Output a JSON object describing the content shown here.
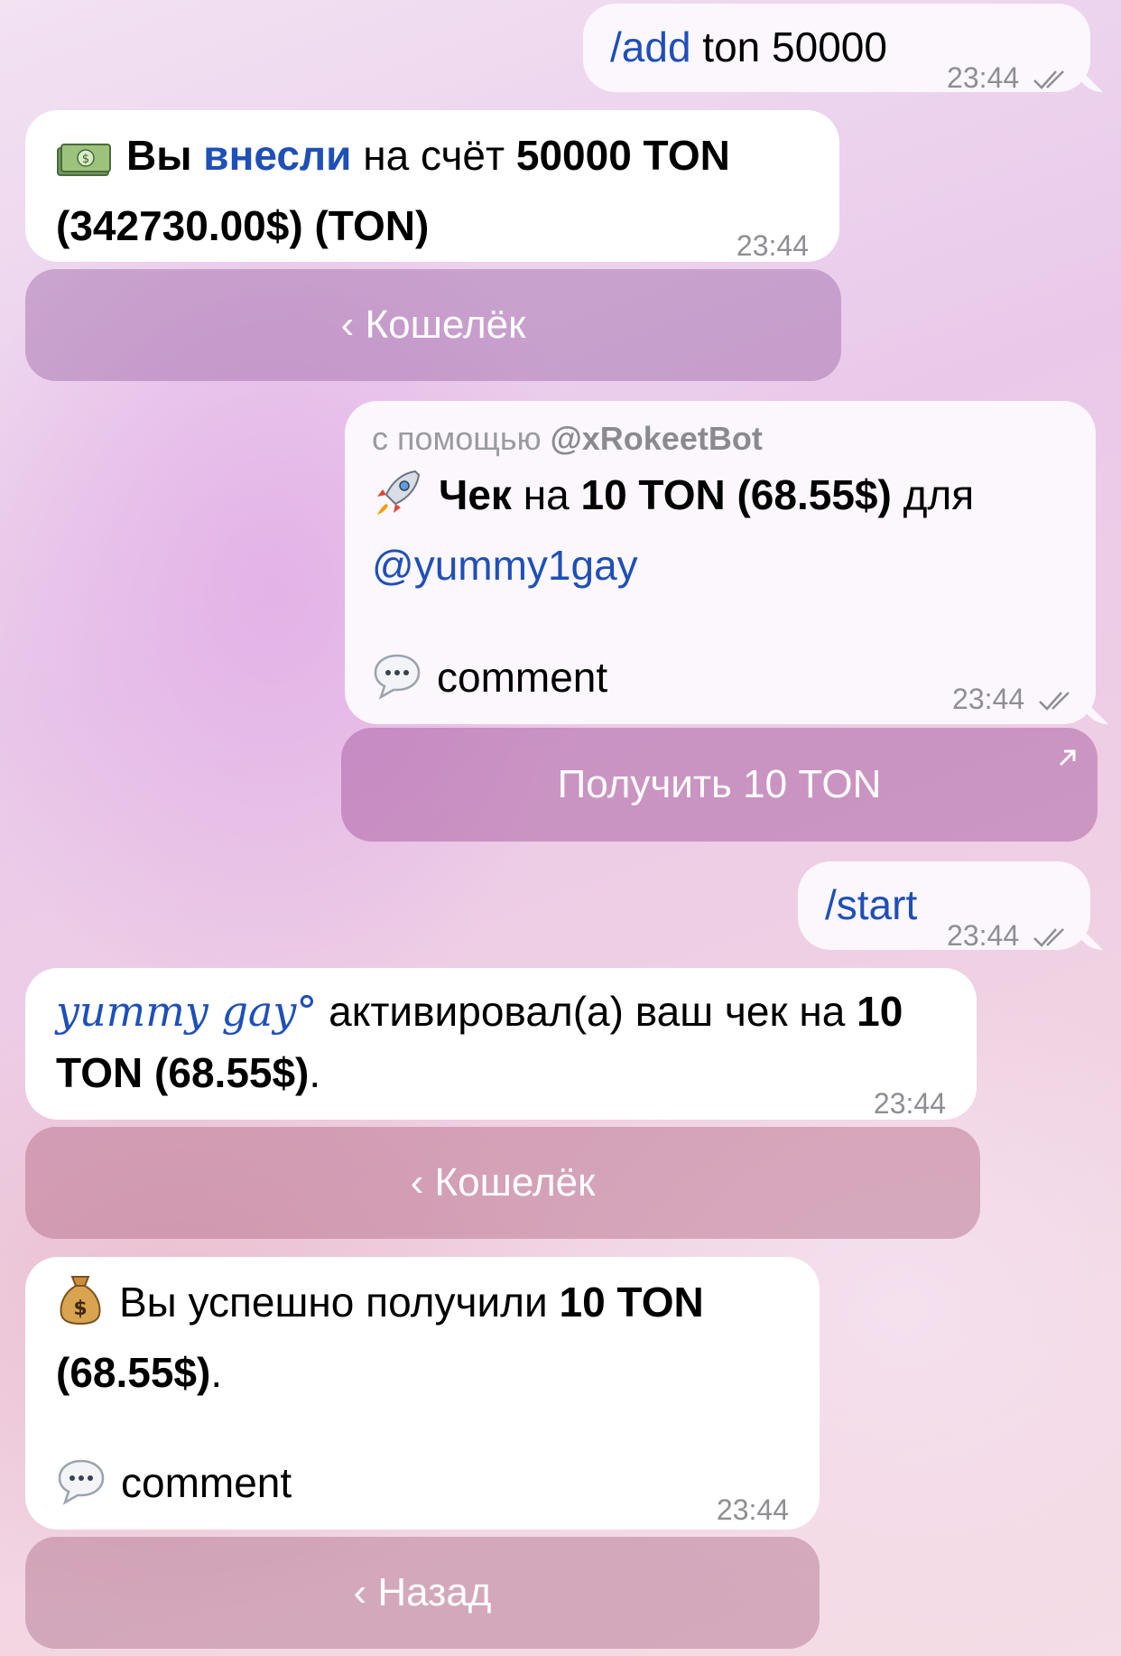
{
  "messages": {
    "m1": {
      "cmd": "/add",
      "rest": " ton 50000",
      "time": "23:44"
    },
    "m2": {
      "icon": "money-bills-icon",
      "p1": "Вы ",
      "p2": "внесли",
      "p3": " на счёт ",
      "p4": "50000 TON (342730.00$) (TON)",
      "time": "23:44",
      "button": "‹ Кошелёк"
    },
    "m3": {
      "via_prefix": "с помощью ",
      "via_bot": "@xRokeetBot",
      "icon": "rocket-icon",
      "p1": "Чек",
      "p2": " на ",
      "p3": "10 TON (68.55$)",
      "p4": " для ",
      "mention": "@yummy1gay",
      "comment_icon": "speech-bubble-icon",
      "comment": "comment",
      "time": "23:44",
      "button": "Получить 10 TON"
    },
    "m4": {
      "cmd": "/start",
      "time": "23:44"
    },
    "m5": {
      "name": "yummy gay°",
      "p1": " активировал(а) ваш чек на ",
      "p2": "10 TON (68.55$)",
      "p3": ".",
      "time": "23:44",
      "button": "‹ Кошелёк"
    },
    "m6": {
      "icon": "money-bag-icon",
      "p1": "Вы успешно получили ",
      "p2": "10 TON (68.55$)",
      "p3": ".",
      "comment_icon": "speech-bubble-icon",
      "comment": "comment",
      "time": "23:44",
      "button": "‹ Назад"
    }
  }
}
